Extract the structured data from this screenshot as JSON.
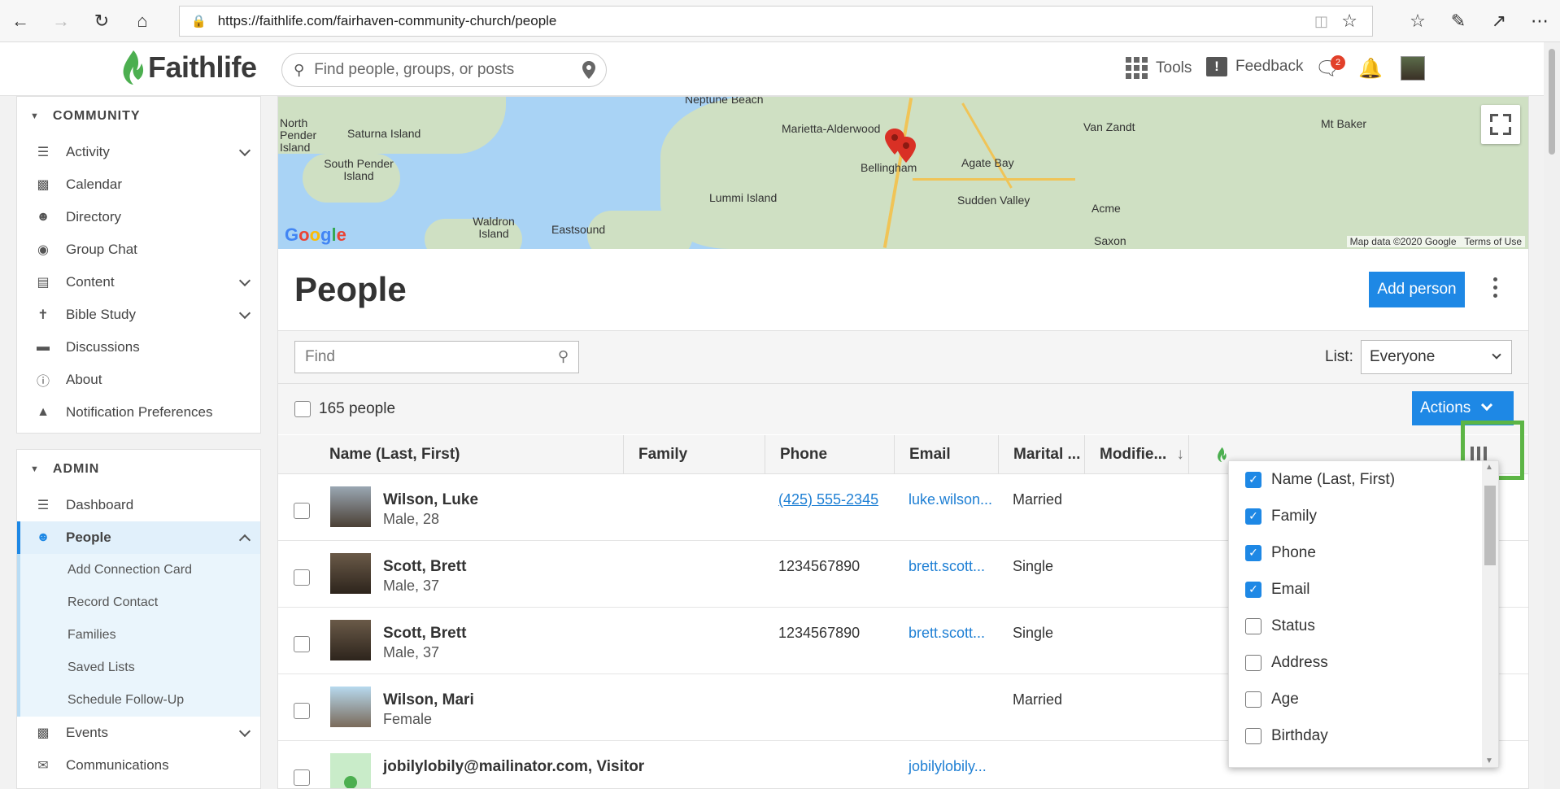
{
  "browser": {
    "url": "https://faithlife.com/fairhaven-community-church/people"
  },
  "header": {
    "brand": "Faithlife",
    "search_placeholder": "Find people, groups, or posts",
    "tools_label": "Tools",
    "feedback_label": "Feedback",
    "notification_count": "2"
  },
  "sidebar": {
    "community_title": "COMMUNITY",
    "community_items": [
      "Activity",
      "Calendar",
      "Directory",
      "Group Chat",
      "Content",
      "Bible Study",
      "Discussions",
      "About",
      "Notification Preferences"
    ],
    "admin_title": "ADMIN",
    "admin_items": [
      "Dashboard",
      "People"
    ],
    "people_subitems": [
      "Add Connection Card",
      "Record Contact",
      "Families",
      "Saved Lists",
      "Schedule Follow-Up"
    ],
    "admin_after": [
      "Events",
      "Communications"
    ]
  },
  "map": {
    "labels": [
      "Neptune Beach",
      "North Pender Island",
      "Saturna Island",
      "Marietta-Alderwood",
      "Van Zandt",
      "Mt Baker",
      "South Pender Island",
      "Bellingham",
      "Agate Bay",
      "Lummi Island",
      "Sudden Valley",
      "Acme",
      "Waldron Island",
      "Eastsound",
      "Saxon"
    ],
    "google": "Google",
    "attribution": "Map data ©2020 Google",
    "terms": "Terms of Use"
  },
  "page": {
    "title": "People",
    "add_button": "Add person",
    "find_placeholder": "Find",
    "list_label": "List:",
    "list_value": "Everyone",
    "count_label": "165 people",
    "actions_label": "Actions"
  },
  "table": {
    "headers": [
      "Name (Last, First)",
      "Family",
      "Phone",
      "Email",
      "Marital ...",
      "Modifie..."
    ],
    "rows": [
      {
        "name": "Wilson, Luke",
        "sub": "Male, 28",
        "phone": "(425) 555-2345",
        "email": "luke.wilson...",
        "marital": "Married"
      },
      {
        "name": "Scott, Brett",
        "sub": "Male, 37",
        "phone": "1234567890",
        "email": "brett.scott...",
        "marital": "Single"
      },
      {
        "name": "Scott, Brett",
        "sub": "Male, 37",
        "phone": "1234567890",
        "email": "brett.scott...",
        "marital": "Single"
      },
      {
        "name": "Wilson, Mari",
        "sub": "Female",
        "phone": "",
        "email": "",
        "marital": "Married"
      },
      {
        "name": "jobilylobily@mailinator.com, Visitor",
        "sub": "",
        "phone": "",
        "email": "jobilylobily...",
        "marital": ""
      }
    ]
  },
  "column_menu": {
    "options": [
      {
        "label": "Name (Last, First)",
        "checked": true
      },
      {
        "label": "Family",
        "checked": true
      },
      {
        "label": "Phone",
        "checked": true
      },
      {
        "label": "Email",
        "checked": true
      },
      {
        "label": "Status",
        "checked": false
      },
      {
        "label": "Address",
        "checked": false
      },
      {
        "label": "Age",
        "checked": false
      },
      {
        "label": "Birthday",
        "checked": false
      }
    ]
  },
  "colors": {
    "accent": "#1e88e5",
    "highlight": "#5cb545",
    "brand_green": "#4caf50"
  }
}
